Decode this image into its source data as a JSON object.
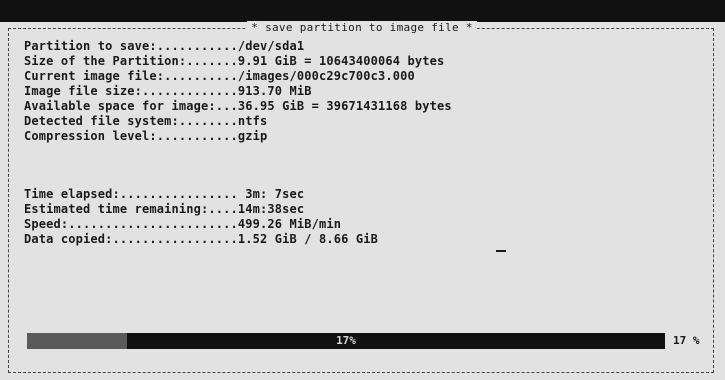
{
  "dialog": {
    "title": "* save partition to image file *"
  },
  "info": [
    {
      "label": "Partition to save:...........",
      "value": "/dev/sda1"
    },
    {
      "label": "Size of the Partition:.......",
      "value": "9.91 GiB = 10643400064 bytes"
    },
    {
      "label": "Current image file:..........",
      "value": "/images/000c29c700c3.000"
    },
    {
      "label": "Image file size:.............",
      "value": "913.70 MiB"
    },
    {
      "label": "Available space for image:...",
      "value": "36.95 GiB = 39671431168 bytes"
    },
    {
      "label": "Detected file system:........",
      "value": "ntfs"
    },
    {
      "label": "Compression level:...........",
      "value": "gzip"
    }
  ],
  "timing": [
    {
      "label": "Time elapsed:................",
      "value": " 3m: 7sec"
    },
    {
      "label": "Estimated time remaining:....",
      "value": "14m:38sec"
    },
    {
      "label": "Speed:.......................",
      "value": "499.26 MiB/min"
    },
    {
      "label": "Data copied:.................",
      "value": "1.52 GiB / 8.66 GiB"
    }
  ],
  "progress": {
    "fraction": 0.156,
    "bar_label": "17%",
    "percent_text": "17 %"
  },
  "colors": {
    "background": "#e2e2e2",
    "text": "#1a1a1a",
    "progress_track": "#111111",
    "progress_fill": "#5a5a5a"
  }
}
